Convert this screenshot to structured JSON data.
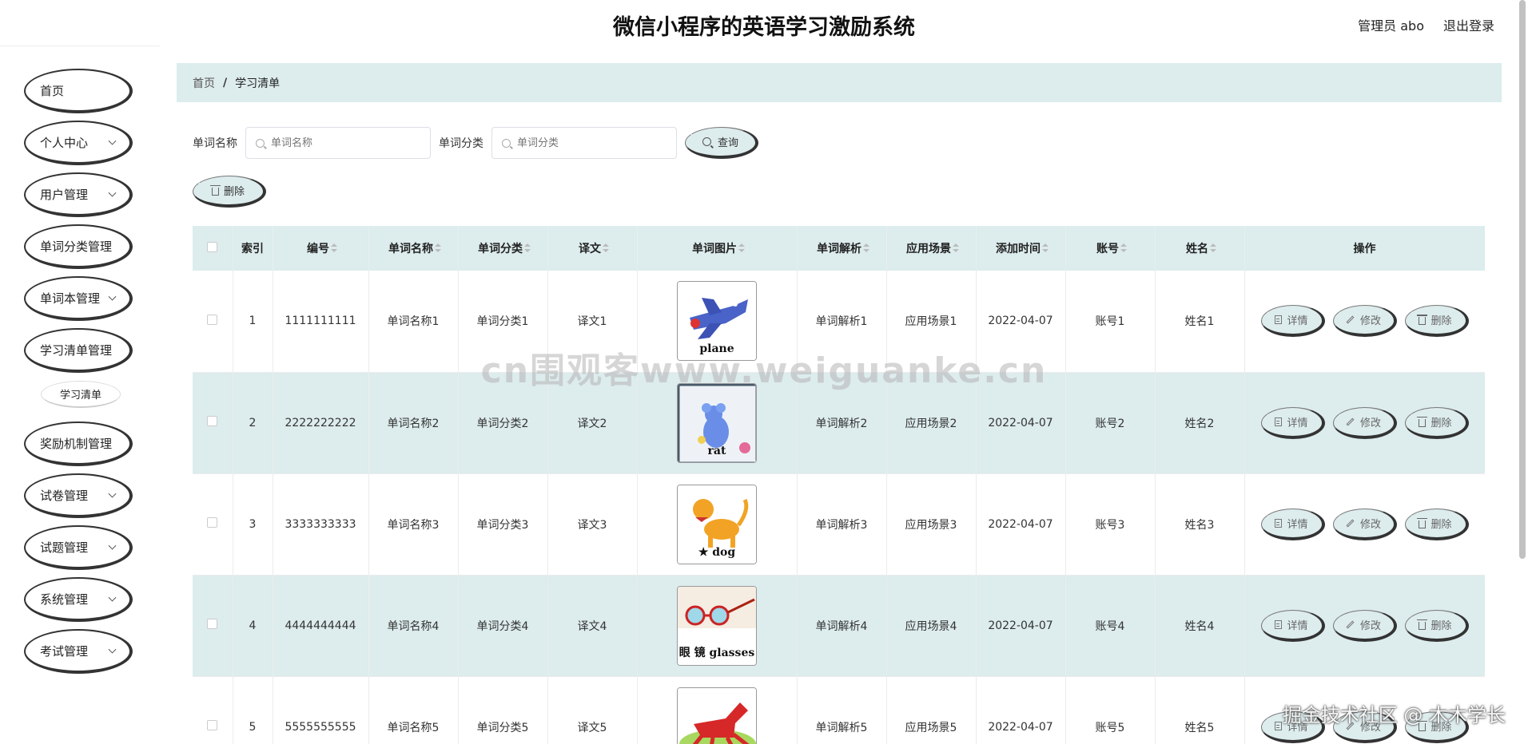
{
  "header": {
    "title": "微信小程序的英语学习激励系统",
    "user_label": "管理员 abo",
    "logout_label": "退出登录"
  },
  "sidebar": {
    "items": [
      {
        "label": "首页",
        "has_arrow": false
      },
      {
        "label": "个人中心",
        "has_arrow": true
      },
      {
        "label": "用户管理",
        "has_arrow": true
      },
      {
        "label": "单词分类管理",
        "has_arrow": false
      },
      {
        "label": "单词本管理",
        "has_arrow": true
      },
      {
        "label": "学习清单管理",
        "has_arrow": false
      },
      {
        "label": "奖励机制管理",
        "has_arrow": false
      },
      {
        "label": "试卷管理",
        "has_arrow": true
      },
      {
        "label": "试题管理",
        "has_arrow": true
      },
      {
        "label": "系统管理",
        "has_arrow": true
      },
      {
        "label": "考试管理",
        "has_arrow": true
      }
    ],
    "sub_item": "学习清单"
  },
  "breadcrumb": {
    "home": "首页",
    "separator": "/",
    "current": "学习清单"
  },
  "search": {
    "word_name_label": "单词名称",
    "word_name_placeholder": "单词名称",
    "word_category_label": "单词分类",
    "word_category_placeholder": "单词分类",
    "query_label": "查询",
    "delete_label": "删除"
  },
  "table": {
    "headers": {
      "index": "索引",
      "code": "编号",
      "word_name": "单词名称",
      "word_category": "单词分类",
      "translation": "译文",
      "word_image": "单词图片",
      "analysis": "单词解析",
      "scene": "应用场景",
      "added_time": "添加时间",
      "account": "账号",
      "name": "姓名",
      "actions": "操作"
    },
    "action_labels": {
      "detail": "详情",
      "edit": "修改",
      "delete": "删除"
    },
    "rows": [
      {
        "index": "1",
        "code": "1111111111",
        "word_name": "单词名称1",
        "word_category": "单词分类1",
        "translation": "译文1",
        "image_caption": "plane",
        "image_icon": "plane-image",
        "analysis": "单词解析1",
        "scene": "应用场景1",
        "added_time": "2022-04-07",
        "account": "账号1",
        "name": "姓名1"
      },
      {
        "index": "2",
        "code": "2222222222",
        "word_name": "单词名称2",
        "word_category": "单词分类2",
        "translation": "译文2",
        "image_caption": "rat",
        "image_icon": "rat-image",
        "analysis": "单词解析2",
        "scene": "应用场景2",
        "added_time": "2022-04-07",
        "account": "账号2",
        "name": "姓名2"
      },
      {
        "index": "3",
        "code": "3333333333",
        "word_name": "单词名称3",
        "word_category": "单词分类3",
        "translation": "译文3",
        "image_caption": "★ dog",
        "image_icon": "dog-image",
        "analysis": "单词解析3",
        "scene": "应用场景3",
        "added_time": "2022-04-07",
        "account": "账号3",
        "name": "姓名3"
      },
      {
        "index": "4",
        "code": "4444444444",
        "word_name": "单词名称4",
        "word_category": "单词分类4",
        "translation": "译文4",
        "image_caption": "眼 镜 glasses",
        "image_icon": "glasses-image",
        "analysis": "单词解析4",
        "scene": "应用场景4",
        "added_time": "2022-04-07",
        "account": "账号4",
        "name": "姓名4"
      },
      {
        "index": "5",
        "code": "5555555555",
        "word_name": "单词名称5",
        "word_category": "单词分类5",
        "translation": "译文5",
        "image_caption": "",
        "image_icon": "horse-image",
        "analysis": "单词解析5",
        "scene": "应用场景5",
        "added_time": "2022-04-07",
        "account": "账号5",
        "name": "姓名5"
      }
    ]
  },
  "watermarks": {
    "center": "cn围观客www.weiguanke.cn",
    "corner": "掘金技术社区 @ 木木学长"
  },
  "colors": {
    "accent_bg": "#ddeced",
    "text": "#333333"
  }
}
